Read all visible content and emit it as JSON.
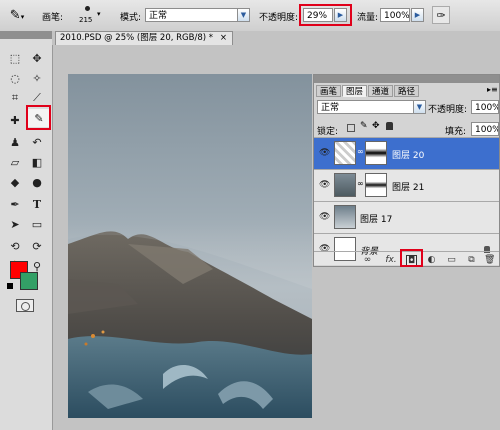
{
  "options_bar": {
    "brush_label": "画笔:",
    "brush_size": "215",
    "mode_label": "模式:",
    "mode_value": "正常",
    "opacity_label": "不透明度:",
    "opacity_value": "29%",
    "flow_label": "流量:",
    "flow_value": "100%"
  },
  "document": {
    "tab_title": "2010.PSD @ 25% (图层 20, RGB/8) *",
    "close_glyph": "×"
  },
  "layers_panel": {
    "tabs": [
      "画笔",
      "图层",
      "通道",
      "路径"
    ],
    "active_tab_index": 1,
    "blend_mode": "正常",
    "opacity_label": "不透明度:",
    "opacity_value": "100%",
    "lock_label": "锁定:",
    "fill_label": "填充:",
    "fill_value": "100%",
    "layers": [
      {
        "name": "图层 20",
        "selected": true
      },
      {
        "name": "图层 21",
        "selected": false
      },
      {
        "name": "图层 17",
        "selected": false
      },
      {
        "name": "背景",
        "selected": false
      }
    ],
    "footer_fx": "fx."
  },
  "colors": {
    "foreground": "#ff0000",
    "background": "#33a066",
    "highlight": "#e0001a",
    "selection": "#3d6fce"
  },
  "icons": {
    "brush_tool": "brush-icon",
    "eye": "eye-icon",
    "add_mask": "add-mask-icon"
  }
}
